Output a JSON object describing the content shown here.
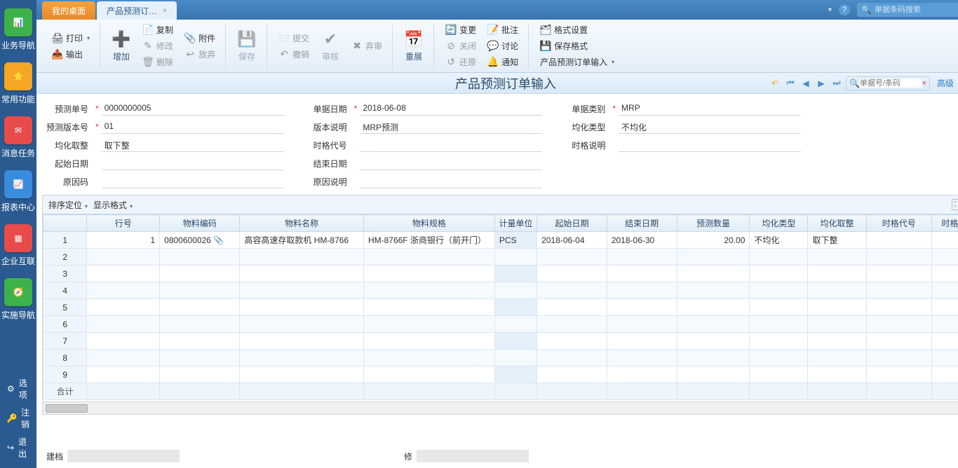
{
  "topbar": {
    "tabs": {
      "desktop": "我的桌面",
      "active": "产品预测订…"
    },
    "search_placeholder": "单据条码搜索"
  },
  "sidebar": {
    "items": [
      {
        "label": "业务导航",
        "color": "#3eb24a"
      },
      {
        "label": "常用功能",
        "color": "#f5a623"
      },
      {
        "label": "消息任务",
        "color": "#e94b4b"
      },
      {
        "label": "报表中心",
        "color": "#3a8dde"
      },
      {
        "label": "企业互联",
        "color": "#e94b4b"
      },
      {
        "label": "实施导航",
        "color": "#3eb24a"
      }
    ],
    "bottom": {
      "options": "选项",
      "logout": "注销",
      "exit": "退出"
    }
  },
  "ribbon": {
    "print": "打印",
    "export": "输出",
    "add": "增加",
    "copy": "复制",
    "modify": "修改",
    "delete": "删除",
    "attach": "附件",
    "discard": "放弃",
    "save": "保存",
    "submit": "提交",
    "revoke": "撤销",
    "audit": "审核",
    "abandon": "弃审",
    "rebuild": "重展",
    "change": "变更",
    "close": "关闭",
    "restore": "还原",
    "approve": "批注",
    "discuss": "讨论",
    "notify": "通知",
    "format_set": "格式设置",
    "save_format": "保存格式",
    "order_input": "产品预测订单输入"
  },
  "title": {
    "page": "产品预测订单输入",
    "search_placeholder": "单据号/条码",
    "advanced": "高级"
  },
  "form": {
    "labels": {
      "order_no": "预测单号",
      "version_no": "预测版本号",
      "round_opt": "均化取整",
      "start_date": "起始日期",
      "reason_code": "原因码",
      "order_date": "单据日期",
      "version_desc": "版本说明",
      "time_code": "时格代号",
      "end_date": "结束日期",
      "reason_desc": "原因说明",
      "order_type": "单据类别",
      "avg_type": "均化类型",
      "time_desc": "时格说明"
    },
    "values": {
      "order_no": "0000000005",
      "version_no": "01",
      "round_opt": "取下整",
      "start_date": "",
      "reason_code": "",
      "order_date": "2018-06-08",
      "version_desc": "MRP预测",
      "time_code": "",
      "end_date": "",
      "reason_desc": "",
      "order_type": "MRP",
      "avg_type": "不均化",
      "time_desc": ""
    }
  },
  "grid": {
    "toolbar": {
      "sort": "排序定位",
      "display": "显示格式"
    },
    "headers": {
      "rn": "行号",
      "mat_code": "物料编码",
      "mat_name": "物料名称",
      "mat_spec": "物料规格",
      "uom": "计量单位",
      "start": "起始日期",
      "end": "结束日期",
      "qty": "预测数量",
      "avg_type": "均化类型",
      "round": "均化取整",
      "time_code": "时格代号",
      "time_desc": "时格"
    },
    "rows": [
      {
        "rn": "1",
        "no": "1",
        "mat_code": "0800600026",
        "mat_name": "高容高速存取款机 HM-8766",
        "mat_spec": "HM-8766F 浙商银行（前开门）",
        "uom": "PCS",
        "start": "2018-06-04",
        "end": "2018-06-30",
        "qty": "20.00",
        "avg_type": "不均化",
        "round": "取下整",
        "time_code": ""
      },
      {
        "rn": "2"
      },
      {
        "rn": "3"
      },
      {
        "rn": "4"
      },
      {
        "rn": "5"
      },
      {
        "rn": "6"
      },
      {
        "rn": "7"
      },
      {
        "rn": "8"
      },
      {
        "rn": "9"
      }
    ],
    "sum_label": "合计"
  },
  "footer": {
    "creator": "建档",
    "modifier": "修"
  }
}
